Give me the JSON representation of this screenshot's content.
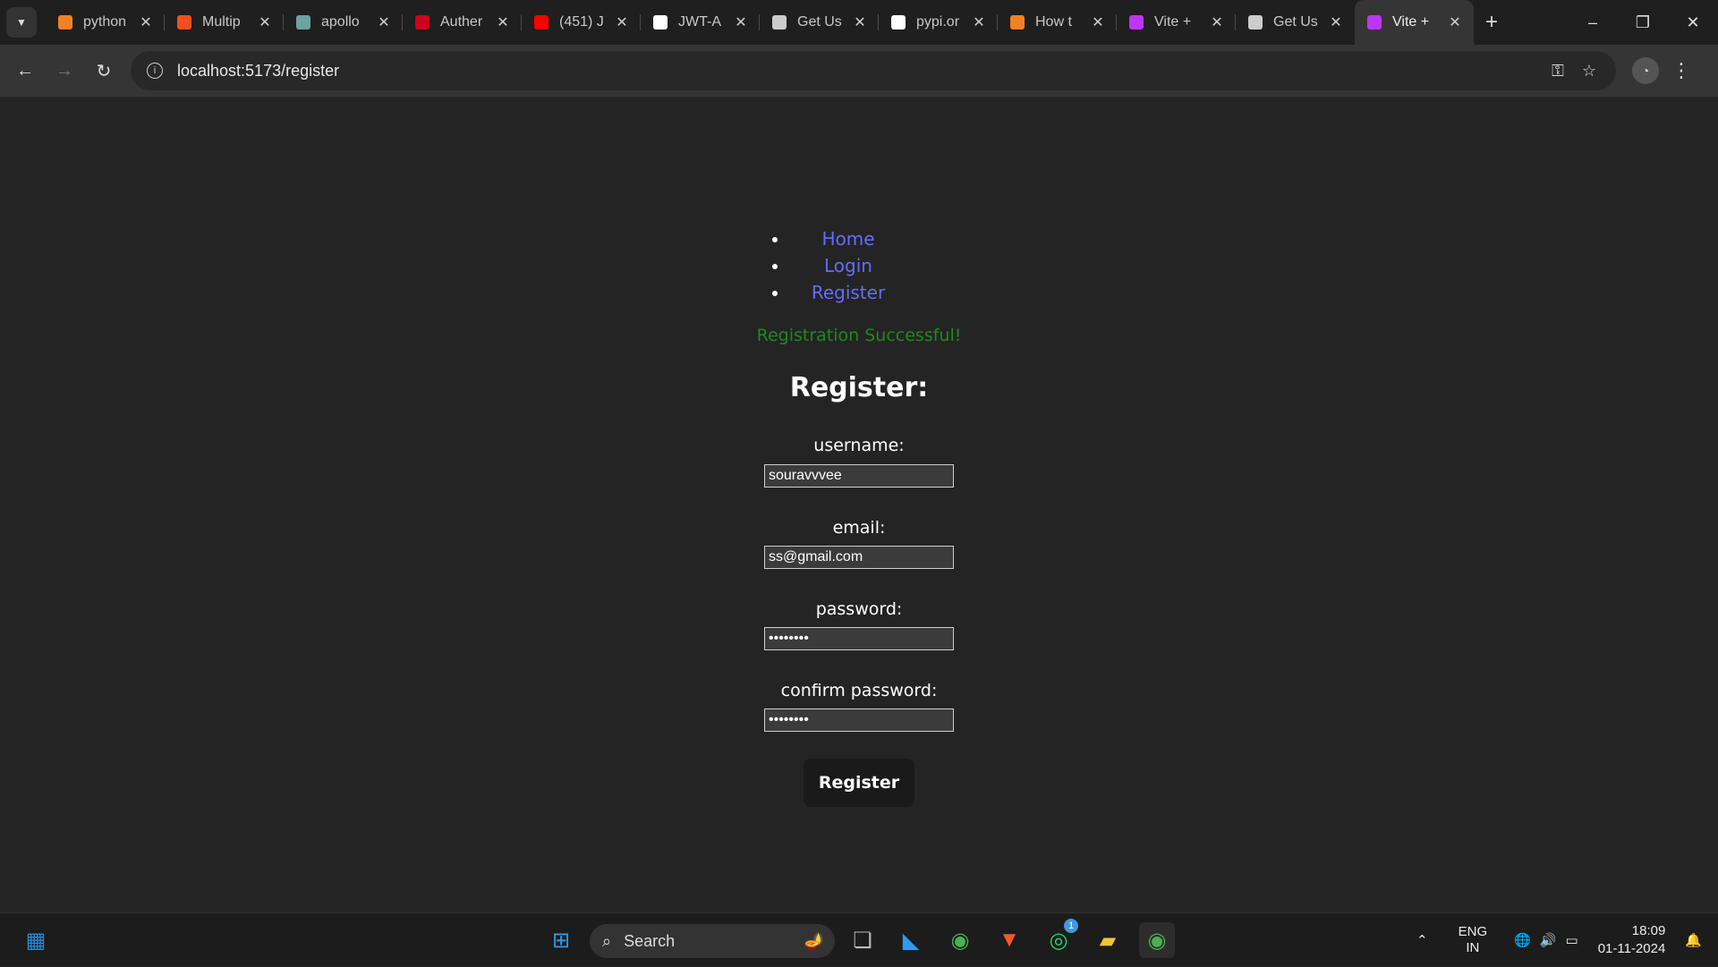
{
  "browser": {
    "tabs": [
      {
        "title": "python",
        "icon": "stackoverflow-icon",
        "color": "#f48024"
      },
      {
        "title": "Multip",
        "icon": "figma-icon",
        "color": "#f24e1e"
      },
      {
        "title": "apollo",
        "icon": "apollo-icon",
        "color": "#6ba3a0"
      },
      {
        "title": "Auther",
        "icon": "auth-icon",
        "color": "#d0021b"
      },
      {
        "title": "(451) J",
        "icon": "youtube-icon",
        "color": "#ff0000"
      },
      {
        "title": "JWT-A",
        "icon": "github-icon",
        "color": "#ffffff"
      },
      {
        "title": "Get Us",
        "icon": "globe-icon",
        "color": "#cccccc"
      },
      {
        "title": "pypi.or",
        "icon": "pypi-icon",
        "color": "#ffffff"
      },
      {
        "title": "How t",
        "icon": "stackoverflow-icon",
        "color": "#f48024"
      },
      {
        "title": "Vite +",
        "icon": "vite-icon",
        "color": "#bd34fe"
      },
      {
        "title": "Get Us",
        "icon": "globe-icon",
        "color": "#cccccc"
      },
      {
        "title": "Vite +",
        "icon": "vite-icon",
        "color": "#bd34fe",
        "active": true
      }
    ],
    "url": "localhost:5173/register"
  },
  "nav": {
    "home": "Home",
    "login": "Login",
    "register": "Register"
  },
  "form": {
    "message": "Registration Successful!",
    "heading": "Register:",
    "username_label": "username:",
    "username_value": "souravvvee",
    "email_label": "email:",
    "email_value": "ss@gmail.com",
    "password_label": "password:",
    "password_value": "••••••••",
    "confirm_label": "confirm password:",
    "confirm_value": "••••••••",
    "submit": "Register"
  },
  "taskbar": {
    "search_label": "Search",
    "lang_top": "ENG",
    "lang_bottom": "IN",
    "time": "18:09",
    "date": "01-11-2024",
    "whatsapp_badge": "1"
  }
}
